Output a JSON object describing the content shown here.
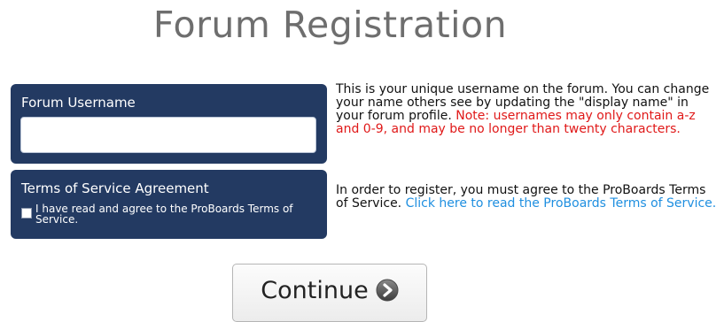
{
  "page": {
    "title": "Forum Registration"
  },
  "username_section": {
    "label": "Forum Username",
    "input_value": "",
    "input_placeholder": "",
    "help_text": "This is your unique username on the forum. You can change your name others see by updating the \"display name\" in your forum profile.",
    "note_text": "Note: usernames may only contain a-z and 0-9, and may be no longer than twenty characters."
  },
  "tos_section": {
    "label": "Terms of Service Agreement",
    "checkbox_label": "I have read and agree to the ProBoards Terms of Service.",
    "checkbox_checked": false,
    "help_text": "In order to register, you must agree to the ProBoards Terms of Service.",
    "link_text": "Click here to read the ProBoards Terms of Service."
  },
  "actions": {
    "continue_label": "Continue",
    "continue_icon": "arrow-right-circle-icon"
  },
  "colors": {
    "panel_bg": "#233a62",
    "note": "#e01919",
    "link": "#1f8fe0",
    "title": "#6e6e6e"
  }
}
